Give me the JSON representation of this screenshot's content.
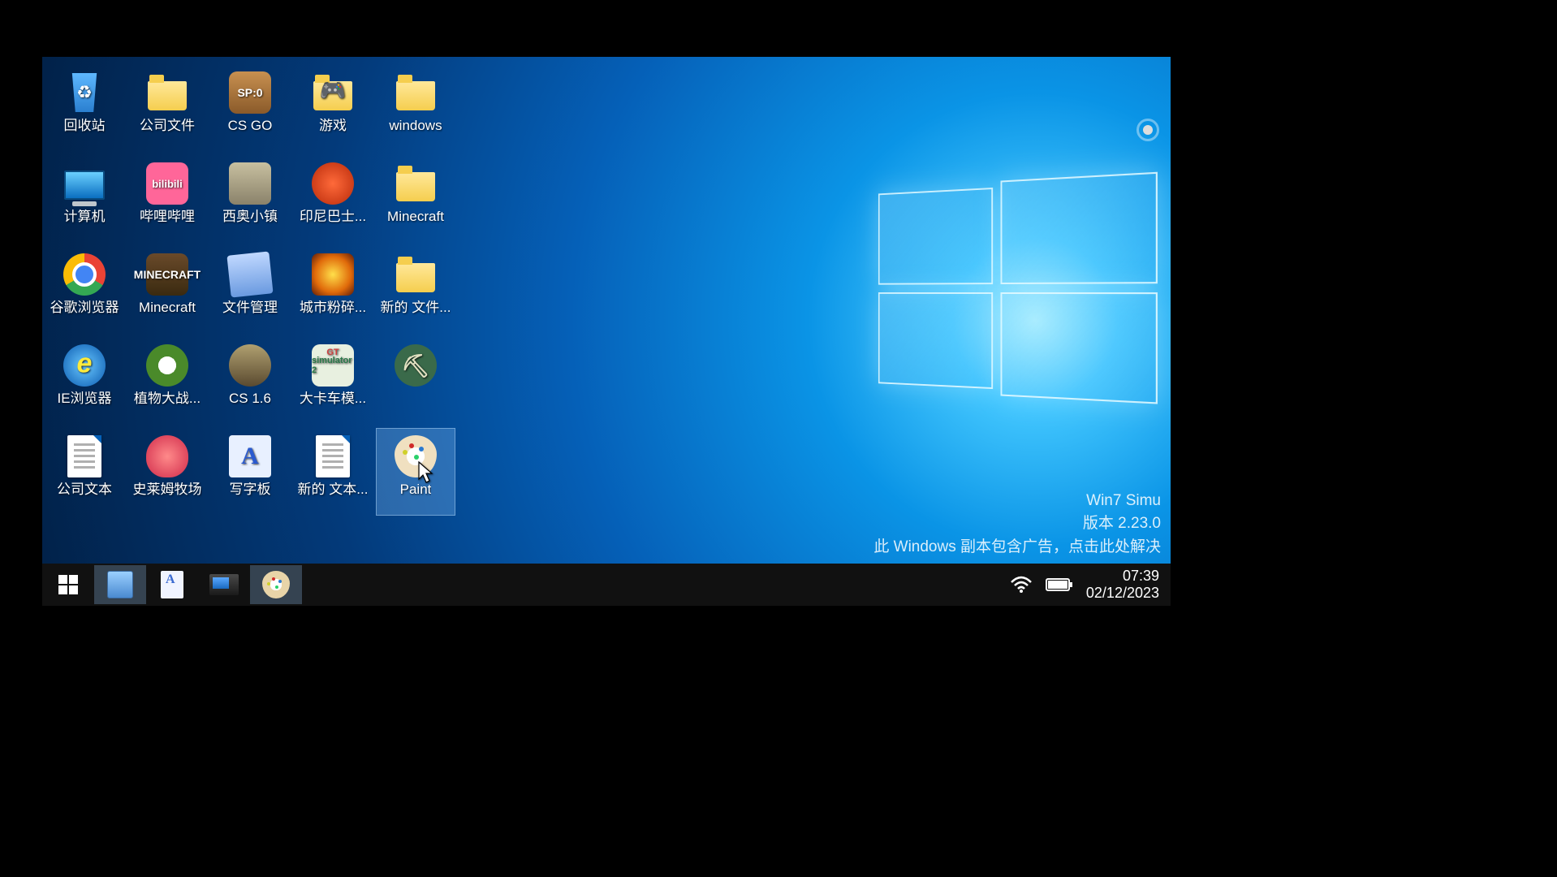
{
  "desktop_icons": [
    {
      "id": "recycle-bin",
      "label": "回收站",
      "kind": "recycle"
    },
    {
      "id": "company-folder",
      "label": "公司文件",
      "kind": "folder"
    },
    {
      "id": "csgo",
      "label": "CS GO",
      "kind": "app-csgo",
      "badge": "SP:0"
    },
    {
      "id": "games-folder",
      "label": "游戏",
      "kind": "folder-gamepad"
    },
    {
      "id": "windows-folder",
      "label": "windows",
      "kind": "folder"
    },
    {
      "id": "computer",
      "label": "计算机",
      "kind": "computer"
    },
    {
      "id": "bilibili",
      "label": "哔哩哔哩",
      "kind": "app-bili",
      "badge": "bilibili"
    },
    {
      "id": "theotown",
      "label": "西奥小镇",
      "kind": "app-town"
    },
    {
      "id": "indo-bus",
      "label": "印尼巴士...",
      "kind": "app-bus"
    },
    {
      "id": "minecraft-folder",
      "label": "Minecraft",
      "kind": "folder"
    },
    {
      "id": "chrome",
      "label": "谷歌浏览器",
      "kind": "app-chrome"
    },
    {
      "id": "minecraft",
      "label": "Minecraft",
      "kind": "app-mc",
      "badge": "MINECRAFT"
    },
    {
      "id": "file-manager",
      "label": "文件管理",
      "kind": "app-notepad"
    },
    {
      "id": "city-smash",
      "label": "城市粉碎...",
      "kind": "app-nuke"
    },
    {
      "id": "new-folder",
      "label": "新的 文件...",
      "kind": "folder"
    },
    {
      "id": "ie",
      "label": "IE浏览器",
      "kind": "app-ie"
    },
    {
      "id": "pvz",
      "label": "植物大战...",
      "kind": "app-plant"
    },
    {
      "id": "cs16",
      "label": "CS 1.6",
      "kind": "app-cs16"
    },
    {
      "id": "truck-sim",
      "label": "大卡车模...",
      "kind": "app-truck",
      "badge": "simulator 2"
    },
    {
      "id": "toolbox",
      "label": "",
      "kind": "app-xmod"
    },
    {
      "id": "company-text",
      "label": "公司文本",
      "kind": "doc"
    },
    {
      "id": "slime-ranch",
      "label": "史莱姆牧场",
      "kind": "app-slime"
    },
    {
      "id": "wordpad",
      "label": "写字板",
      "kind": "app-wordpad",
      "badge": "A"
    },
    {
      "id": "new-text",
      "label": "新的 文本...",
      "kind": "doc"
    },
    {
      "id": "paint",
      "label": "Paint",
      "kind": "app-paint",
      "selected": true
    }
  ],
  "watermark": {
    "line1": "Win7 Simu",
    "line2": "版本 2.23.0",
    "line3": "此 Windows 副本包含广告，点击此处解决"
  },
  "taskbar": {
    "items": [
      {
        "id": "start",
        "icon": "windows"
      },
      {
        "id": "calculator",
        "icon": "calc",
        "active": true
      },
      {
        "id": "wordpad",
        "icon": "wordpad"
      },
      {
        "id": "computer-props",
        "icon": "pc"
      },
      {
        "id": "paint",
        "icon": "paint",
        "active": true
      }
    ],
    "clock_time": "07:39",
    "clock_date": "02/12/2023"
  }
}
